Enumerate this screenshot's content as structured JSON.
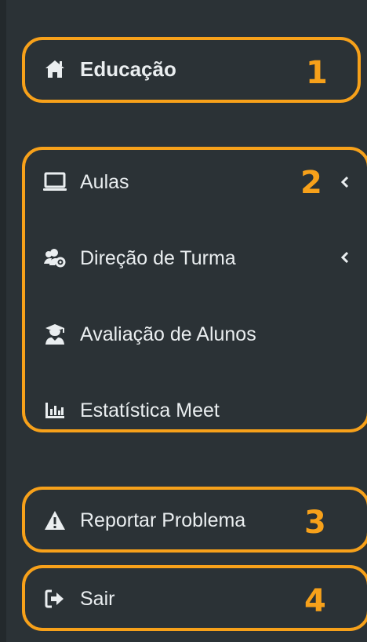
{
  "brand": {
    "label": "Educação",
    "icon": "home-icon"
  },
  "menu": [
    {
      "label": "Aulas",
      "icon": "laptop-icon",
      "has_submenu": true
    },
    {
      "label": "Direção de Turma",
      "icon": "users-cog-icon",
      "has_submenu": true
    },
    {
      "label": "Avaliação de Alunos",
      "icon": "user-graduate-icon",
      "has_submenu": false
    },
    {
      "label": "Estatística Meet",
      "icon": "chart-bar-icon",
      "has_submenu": false
    }
  ],
  "actions": [
    {
      "label": "Reportar Problema",
      "icon": "warning-icon"
    },
    {
      "label": "Sair",
      "icon": "sign-out-icon"
    }
  ],
  "callouts": [
    "1",
    "2",
    "3",
    "4"
  ],
  "colors": {
    "sidebar_bg": "#2b3236",
    "text": "#eaeef0",
    "callout": "#f7a11a"
  }
}
